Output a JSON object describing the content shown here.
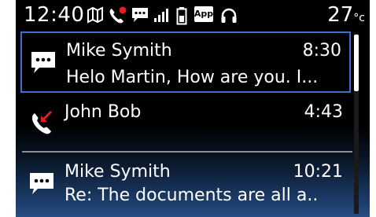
{
  "status_bar": {
    "time": "12:40",
    "temperature": "27",
    "temperature_unit": "°c",
    "app_badge": "App",
    "icons": [
      "map-icon",
      "missed-call-icon",
      "message-icon",
      "signal-icon",
      "battery-icon",
      "app-icon",
      "headphones-icon"
    ]
  },
  "messages": [
    {
      "sender": "Mike Symith",
      "time": "8:30",
      "preview": "Helo Martin, How are you. I...",
      "icon": "message-icon",
      "selected": true
    },
    {
      "sender": "John Bob",
      "time": "4:43",
      "preview": "",
      "icon": "missed-call-icon",
      "selected": false
    },
    {
      "sender": "Mike Symith",
      "time": "10:21",
      "preview": "Re: The documents are all a..",
      "icon": "message-icon",
      "selected": false
    }
  ],
  "colors": {
    "selection_border": "#3c6fd0",
    "missed_call_red": "#e02020",
    "background_bottom": "#274d82"
  }
}
